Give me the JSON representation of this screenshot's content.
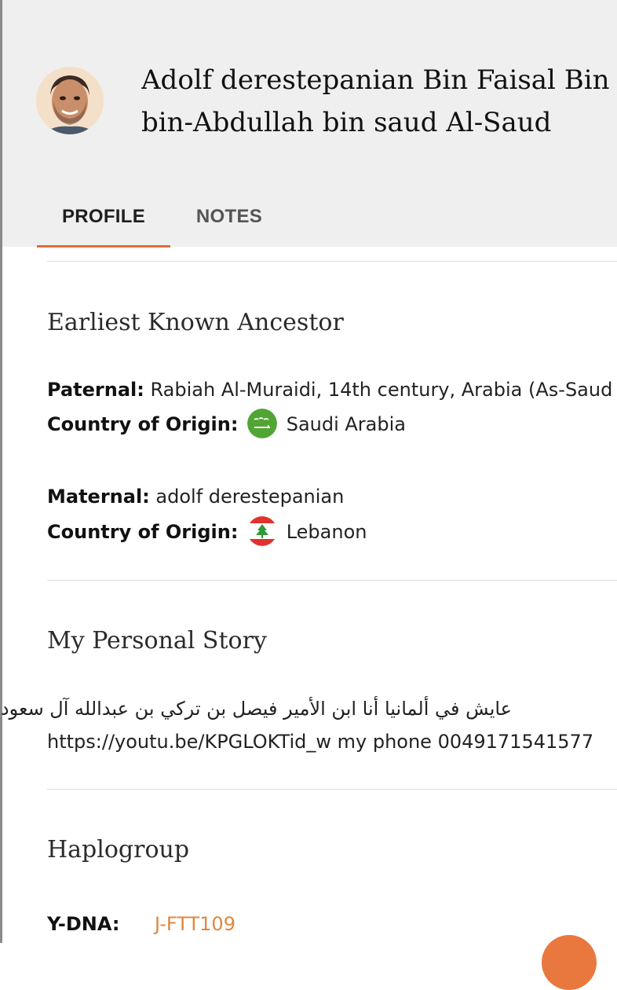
{
  "header": {
    "name_line1": "Adolf derestepanian Bin Faisal Bin",
    "name_line2": "bin-Abdullah bin saud Al-Saud"
  },
  "tabs": [
    {
      "label": "PROFILE",
      "active": true
    },
    {
      "label": "NOTES",
      "active": false
    }
  ],
  "earliest_ancestor": {
    "title": "Earliest Known Ancestor",
    "paternal_label": "Paternal:",
    "paternal_value": "Rabiah Al-Muraidi, 14th century, Arabia (As-Saud",
    "paternal_country_label": "Country of Origin:",
    "paternal_country": "Saudi Arabia",
    "maternal_label": "Maternal:",
    "maternal_value": "adolf derestepanian",
    "maternal_country_label": "Country of Origin:",
    "maternal_country": "Lebanon"
  },
  "personal_story": {
    "title": "My Personal Story",
    "line1": "عايش في ألمانيا أنا ابن الأمير فيصل بن تركي بن عبدالله آل سعود",
    "line2": "https://youtu.be/KPGLOKTid_w my phone 0049171541577"
  },
  "haplogroup": {
    "title": "Haplogroup",
    "ydna_label": "Y-DNA:",
    "ydna_value": "J-FTT109"
  },
  "colors": {
    "accent": "#e56a3c",
    "haplo_link": "#e0873c",
    "header_bg": "#efefef"
  },
  "icons": {
    "saudi_flag": "saudi-arabia-flag-icon",
    "lebanon_flag": "lebanon-flag-icon"
  }
}
